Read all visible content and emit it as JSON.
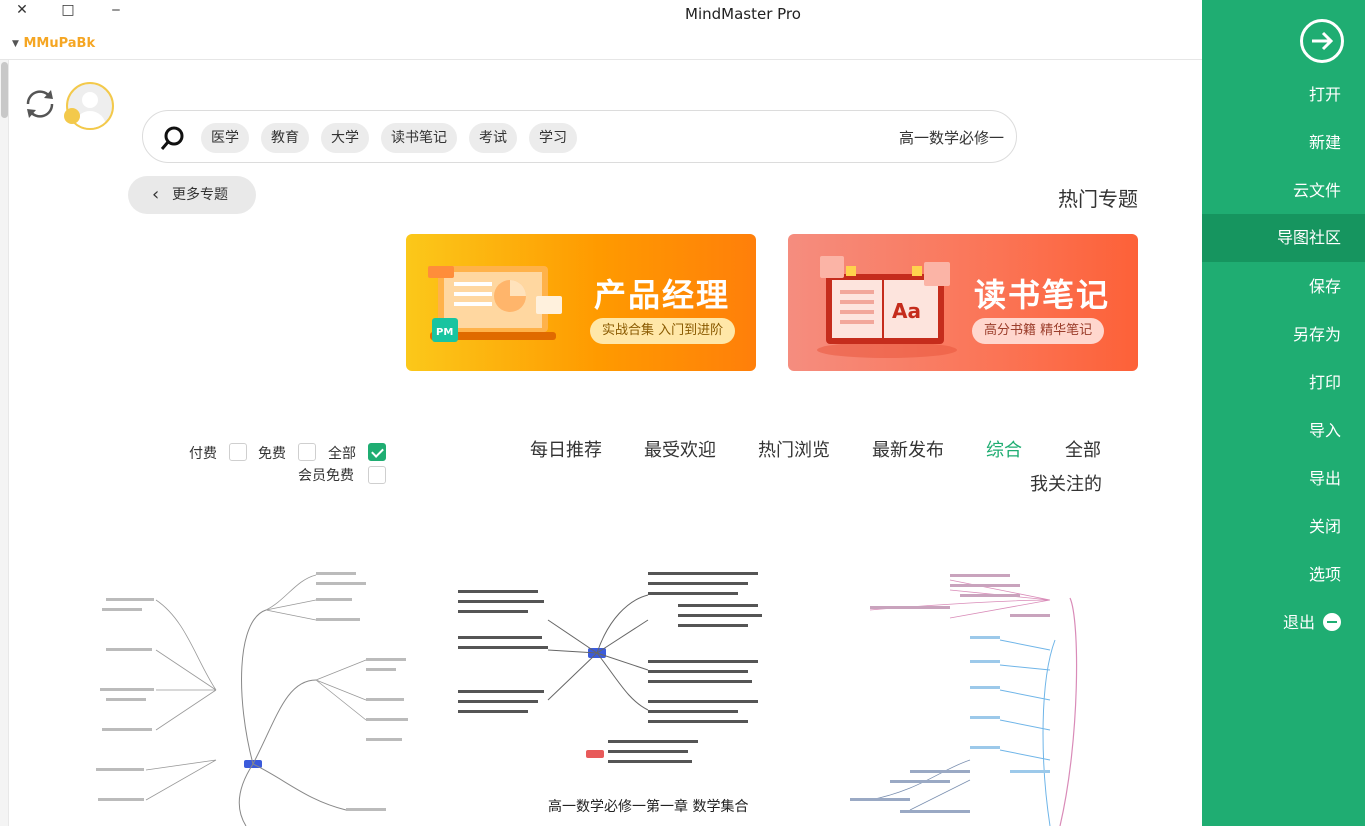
{
  "window": {
    "title": "MindMaster Pro",
    "close_glyph": "✕",
    "maximize_glyph": "□",
    "minimize_glyph": "‒",
    "account_name": "MMuPaBk"
  },
  "sidebar": {
    "back_icon": "arrow-right-circle-icon",
    "items": [
      {
        "label": "打开"
      },
      {
        "label": "新建"
      },
      {
        "label": "云文件"
      },
      {
        "label": "导图社区",
        "active": true
      },
      {
        "label": "保存"
      },
      {
        "label": "另存为"
      },
      {
        "label": "打印"
      },
      {
        "label": "导入"
      },
      {
        "label": "导出"
      },
      {
        "label": "关闭"
      },
      {
        "label": "选项"
      },
      {
        "label": "退出"
      }
    ],
    "bg_color": "#1fad72"
  },
  "search": {
    "value": "高一数学必修一",
    "tags": [
      "学习",
      "考试",
      "读书笔记",
      "大学",
      "教育",
      "医学"
    ]
  },
  "hot": {
    "title": "热门专题",
    "more_label": "更多专题",
    "banners": [
      {
        "title": "读书笔记",
        "subtitle": "高分书籍 精华笔记"
      },
      {
        "title": "产品经理",
        "subtitle": "实战合集 入门到进阶"
      }
    ]
  },
  "filters": {
    "tabs": [
      {
        "label": "全部"
      },
      {
        "label": "综合",
        "active": true
      },
      {
        "label": "最新发布"
      },
      {
        "label": "热门浏览"
      },
      {
        "label": "最受欢迎"
      },
      {
        "label": "每日推荐"
      },
      {
        "label": "我关注的"
      }
    ],
    "price": [
      {
        "label": "全部",
        "checked": true
      },
      {
        "label": "免费",
        "checked": false
      },
      {
        "label": "付费",
        "checked": false
      },
      {
        "label": "会员免费",
        "checked": false
      }
    ]
  },
  "cards": [
    {
      "title": "高一数学必修一第一章 数学集合"
    }
  ]
}
